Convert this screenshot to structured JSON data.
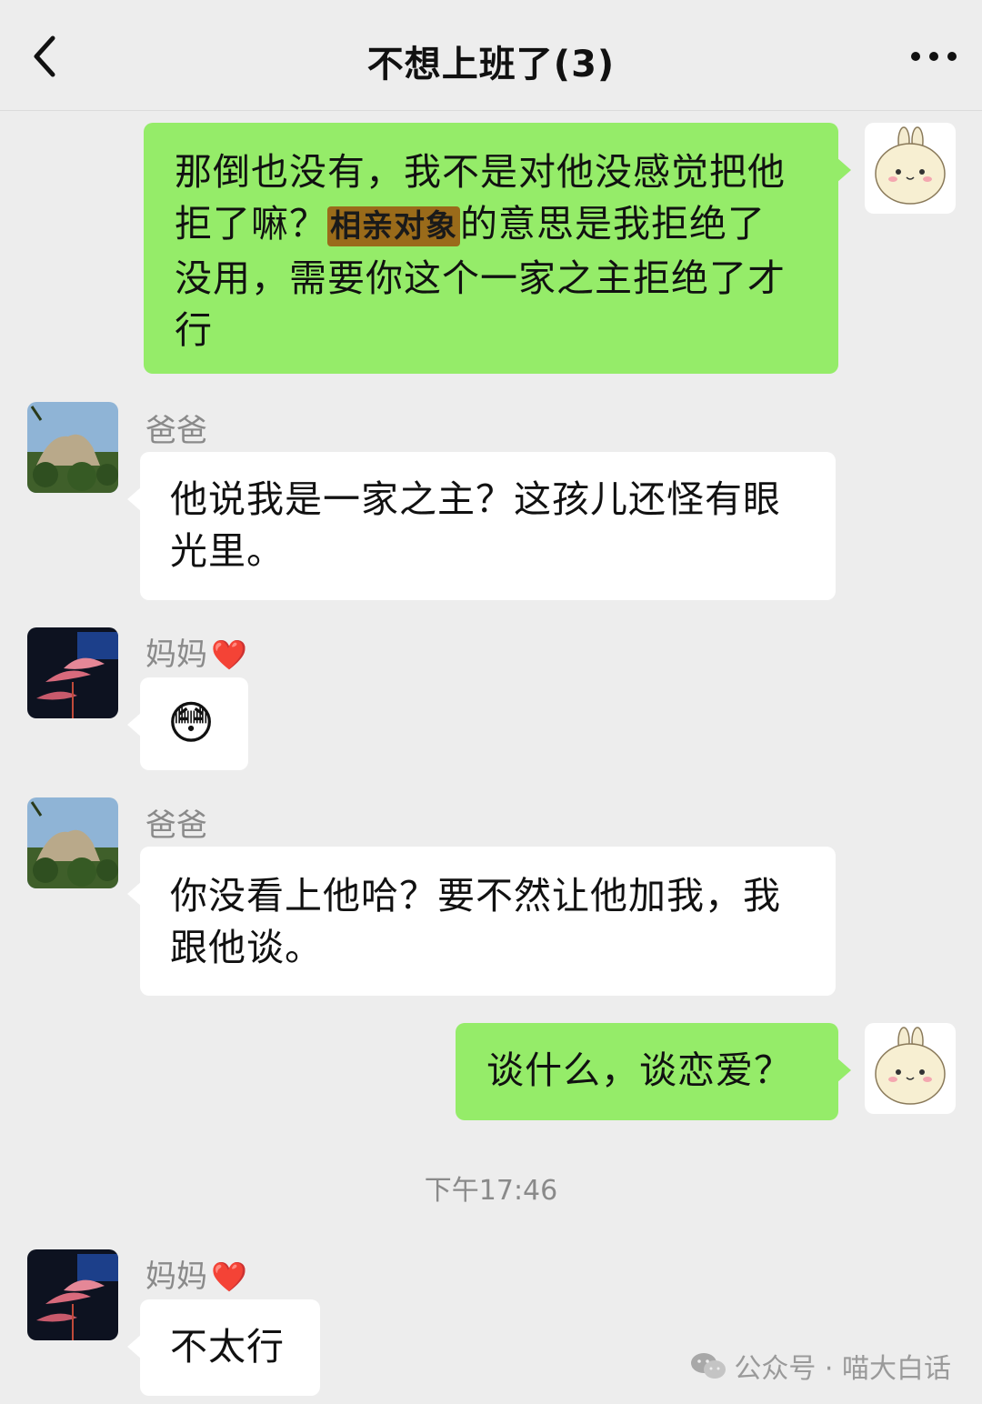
{
  "header": {
    "title": "不想上班了(3)"
  },
  "messages": [
    {
      "side": "right",
      "text_before": "那倒也没有，我不是对他没感觉把他拒了嘛？",
      "highlight": "相亲对象",
      "text_after": "的意思是我拒绝了没用，需要你这个一家之主拒绝了才行"
    },
    {
      "side": "left",
      "sender": "爸爸",
      "text": "他说我是一家之主？这孩儿还怪有眼光里。"
    },
    {
      "side": "left",
      "sender": "妈妈",
      "sender_heart": "❤️",
      "emoji": "😳"
    },
    {
      "side": "left",
      "sender": "爸爸",
      "text": "你没看上他哈？要不然让他加我，我跟他谈。"
    },
    {
      "side": "right",
      "text": "谈什么，谈恋爱？"
    },
    {
      "side": "left",
      "sender": "妈妈",
      "sender_heart": "❤️",
      "text": "不太行"
    }
  ],
  "timestamp": "下午17:46",
  "watermark": "公众号 · 喵大白话",
  "icons": {
    "back": "chevron-left-icon",
    "more": "more-dots-icon",
    "watermark": "wechat-icon"
  },
  "colors": {
    "background": "#ededed",
    "outgoing_bubble": "#95ec69",
    "incoming_bubble": "#ffffff",
    "heart": "#e11d2a"
  }
}
